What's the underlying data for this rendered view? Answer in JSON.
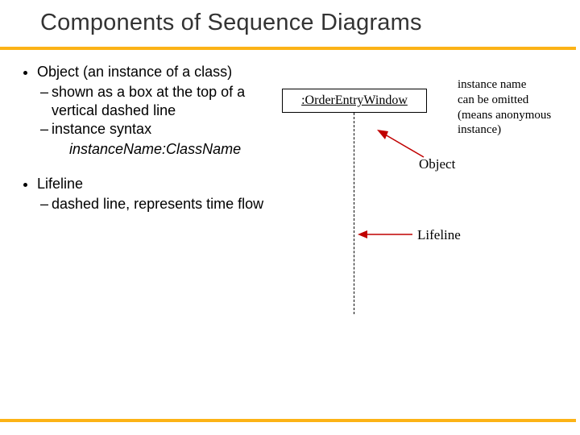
{
  "title": "Components of Sequence Diagrams",
  "bullets": {
    "b1": "Object (an instance of a class)",
    "b1a": "shown as a box at the top of a vertical dashed line",
    "b1b": "instance syntax",
    "b1syntax": "instanceName:ClassName",
    "b2": "Lifeline",
    "b2a": "dashed line, represents time flow"
  },
  "diagram": {
    "object_box": ":OrderEntryWindow",
    "object_label": "Object",
    "lifeline_label": "Lifeline"
  },
  "note": {
    "l1": "instance name",
    "l2": "can be omitted",
    "l3": "(means anonymous",
    "l4": "instance)"
  }
}
